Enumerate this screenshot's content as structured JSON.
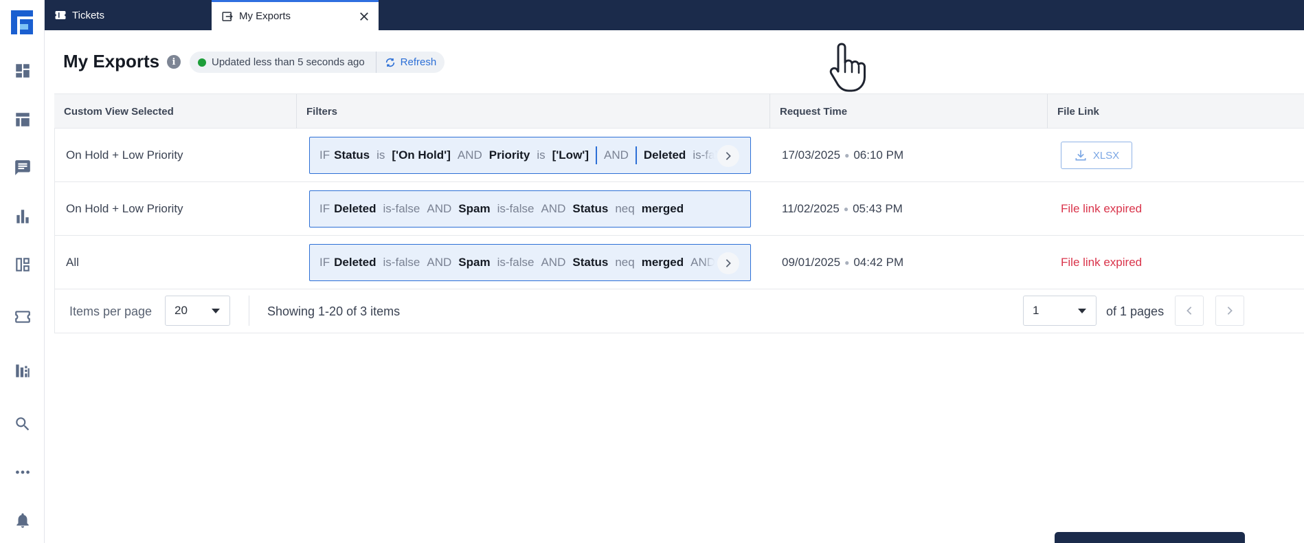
{
  "tabs": [
    {
      "label": "Tickets",
      "icon": "ticket-icon",
      "active": false
    },
    {
      "label": "My Exports",
      "icon": "export-icon",
      "active": true
    }
  ],
  "sidebar": {
    "items": [
      {
        "name": "dashboard",
        "icon": "dashboard-icon"
      },
      {
        "name": "table-view",
        "icon": "table-icon"
      },
      {
        "name": "conversations",
        "icon": "chat-icon"
      },
      {
        "name": "reports",
        "icon": "bar-chart-icon"
      },
      {
        "name": "layouts",
        "icon": "layout-icon"
      },
      {
        "name": "tickets",
        "icon": "ticket-icon"
      },
      {
        "name": "analytics",
        "icon": "analytics-icon"
      },
      {
        "name": "search",
        "icon": "search-icon"
      },
      {
        "name": "more",
        "icon": "more-icon"
      },
      {
        "name": "notifications",
        "icon": "bell-icon"
      }
    ]
  },
  "header": {
    "title": "My Exports",
    "status_text": "Updated less than 5 seconds ago",
    "refresh_label": "Refresh"
  },
  "table": {
    "columns": [
      "Custom View Selected",
      "Filters",
      "Request Time",
      "File Link"
    ],
    "rows": [
      {
        "view": "On Hold + Low Priority",
        "filter": {
          "kw": "IF",
          "f1": "Status",
          "o1": "is",
          "v1": "['On Hold']",
          "a1": "AND",
          "f2": "Priority",
          "o2": "is",
          "v2": "['Low']",
          "a2": "AND",
          "f3": "Deleted",
          "o3": "is-fals"
        },
        "date": "17/03/2025",
        "time": "06:10 PM",
        "file": {
          "type": "button",
          "label": "XLSX"
        }
      },
      {
        "view": "On Hold + Low Priority",
        "filter": {
          "kw": "IF",
          "f1": "Deleted",
          "o1": "is-false",
          "a1": "AND",
          "f2": "Spam",
          "o2": "is-false",
          "a2": "AND",
          "f3": "Status",
          "o3": "neq",
          "v3": "merged"
        },
        "date": "11/02/2025",
        "time": "05:43 PM",
        "file": {
          "type": "text",
          "label": "File link expired"
        }
      },
      {
        "view": "All",
        "filter": {
          "kw": "IF",
          "f1": "Deleted",
          "o1": "is-false",
          "a1": "AND",
          "f2": "Spam",
          "o2": "is-false",
          "a2": "AND",
          "f3": "Status",
          "o3": "neq",
          "v3": "merged",
          "a3": "AND"
        },
        "date": "09/01/2025",
        "time": "04:42 PM",
        "file": {
          "type": "text",
          "label": "File link expired"
        }
      }
    ]
  },
  "pagination": {
    "items_per_page_label": "Items per page",
    "items_per_page": "20",
    "showing": "Showing 1-20 of 3 items",
    "current_page": "1",
    "of_pages": "of 1 pages"
  },
  "colors": {
    "topbar": "#1b2b4b",
    "accent": "#2c6fd6",
    "expired": "#d9334a",
    "status_dot": "#1e9e3a"
  }
}
